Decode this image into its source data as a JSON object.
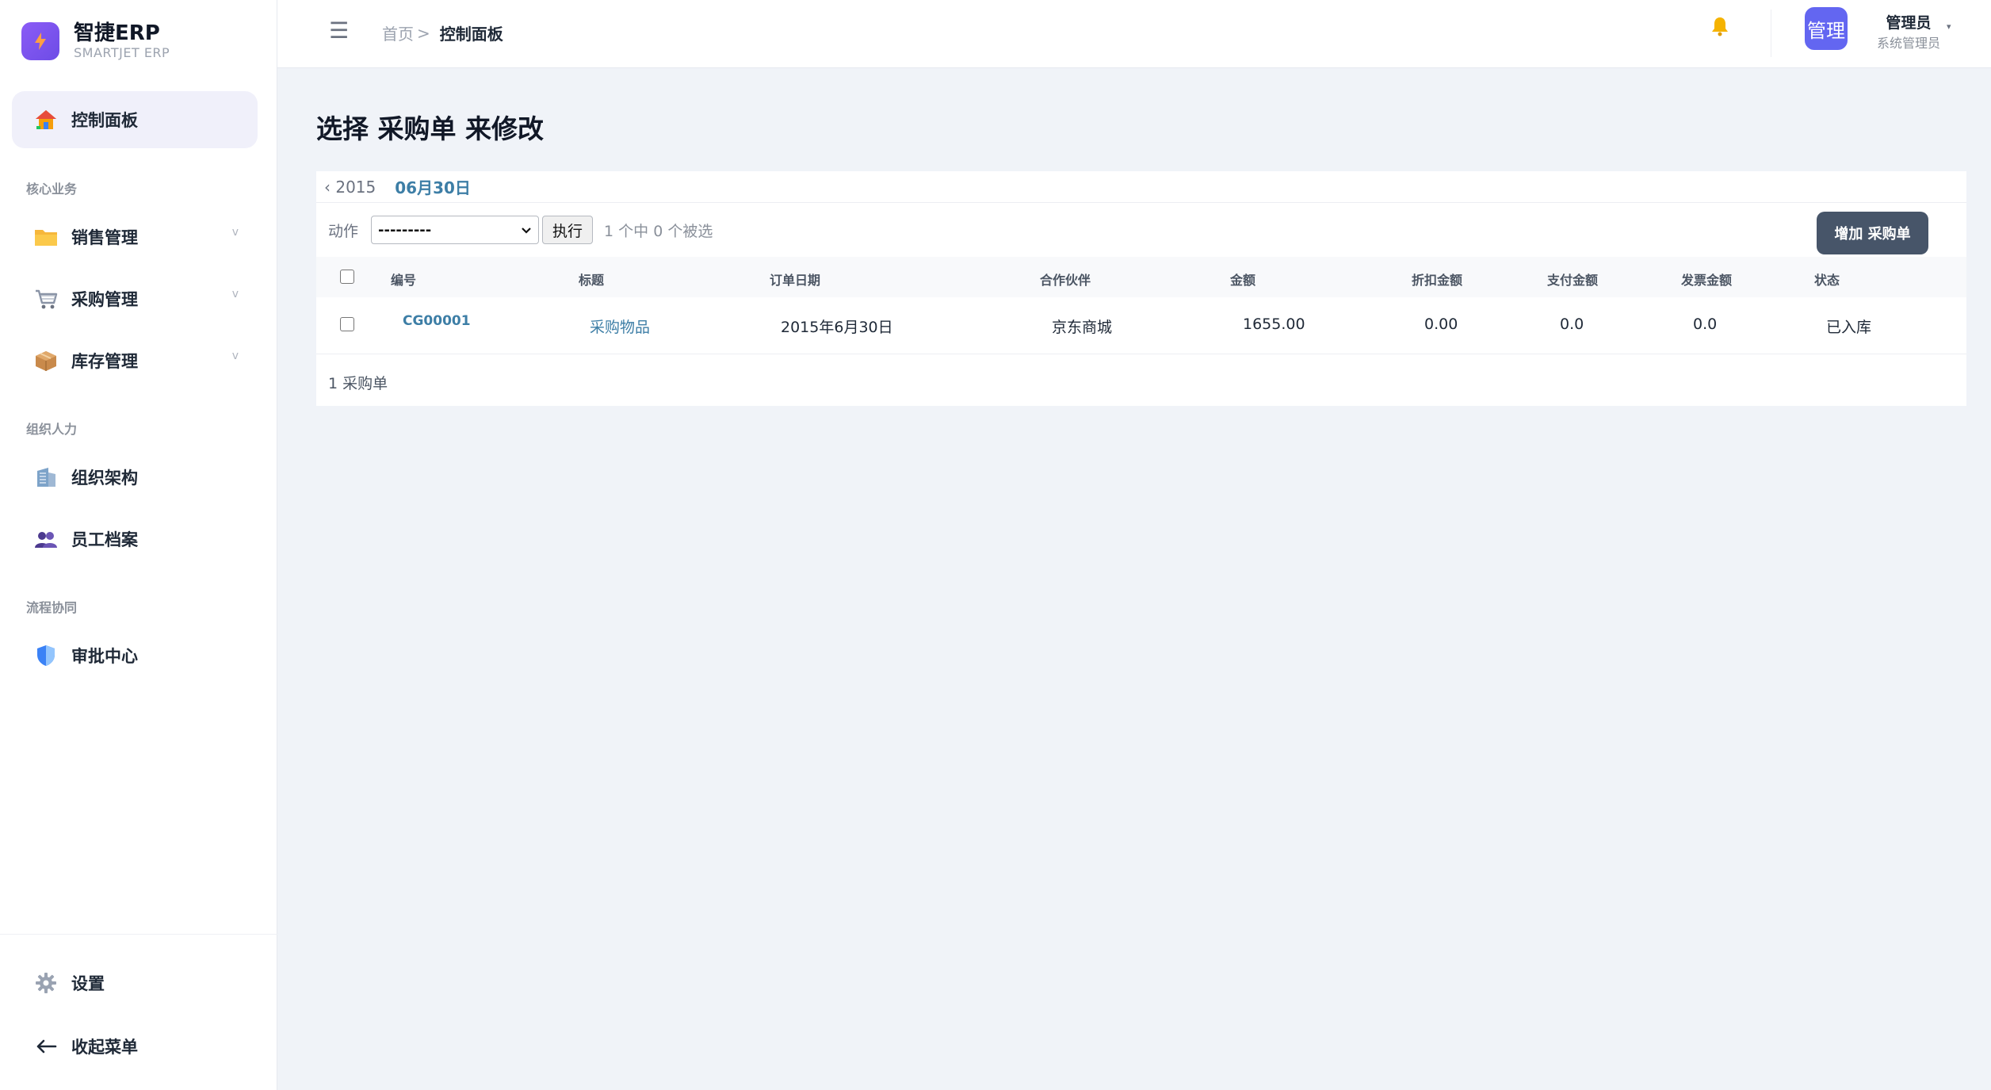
{
  "brand": {
    "title": "智捷ERP",
    "subtitle": "SMARTJET ERP"
  },
  "sidebar": {
    "dashboard": {
      "label": "控制面板",
      "icon": "house-icon"
    },
    "sections": [
      {
        "title": "核心业务"
      },
      {
        "title": "组织人力"
      },
      {
        "title": "流程协同"
      }
    ],
    "items": [
      {
        "label": "销售管理",
        "icon": "folder-icon",
        "expandable": true
      },
      {
        "label": "采购管理",
        "icon": "cart-icon",
        "expandable": true
      },
      {
        "label": "库存管理",
        "icon": "package-icon",
        "expandable": true
      },
      {
        "label": "组织架构",
        "icon": "building-icon"
      },
      {
        "label": "员工档案",
        "icon": "people-icon"
      },
      {
        "label": "审批中心",
        "icon": "shield-icon"
      }
    ],
    "chevron": "v",
    "settings": {
      "label": "设置",
      "icon": "gear-icon"
    },
    "collapse": {
      "label": "收起菜单",
      "icon": "arrow-left-icon"
    }
  },
  "topbar": {
    "breadcrumb_home": "首页",
    "breadcrumb_sep": ">",
    "breadcrumb_current": "控制面板",
    "user": {
      "avatar_text": "管理",
      "name": "管理员",
      "role": "系统管理员"
    },
    "accent_color": "#6366f1"
  },
  "main": {
    "title": "选择 采购单 来修改",
    "date_back": "‹ 2015",
    "date_current": "06月30日",
    "actions_label": "动作",
    "action_selected": "---------",
    "go_label": "执行",
    "selection_count": "1 个中 0 个被选",
    "add_label": "增加 采购单",
    "columns": [
      "编号",
      "标题",
      "订单日期",
      "合作伙伴",
      "金额",
      "折扣金额",
      "支付金额",
      "发票金额",
      "状态"
    ],
    "rows": [
      {
        "id": "CG00001",
        "title": "采购物品",
        "order_date": "2015年6月30日",
        "partner": "京东商城",
        "amount": "1655.00",
        "discount": "0.00",
        "paid": "0.0",
        "invoiced": "0.0",
        "status": "已入库"
      }
    ],
    "result_count": "1 采购单"
  }
}
